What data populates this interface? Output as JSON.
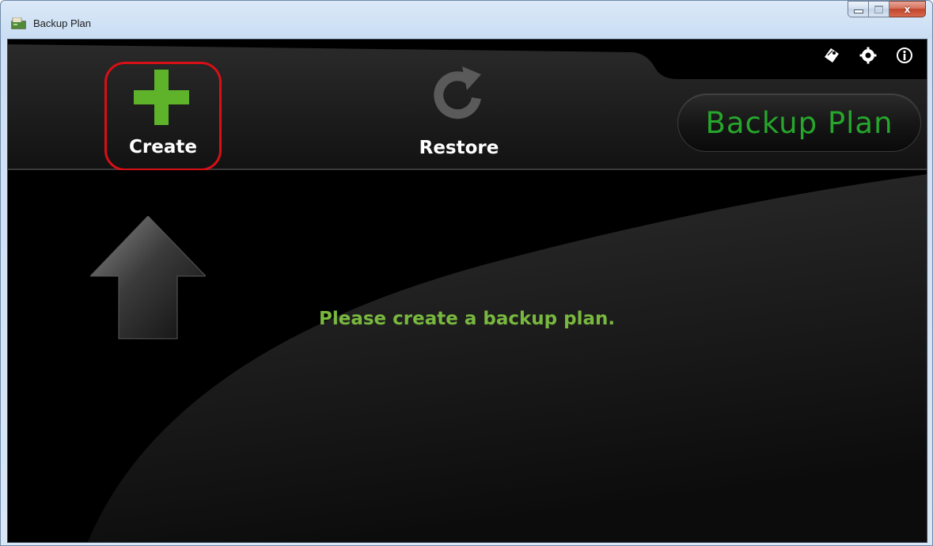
{
  "window": {
    "title": "Backup Plan",
    "controls": {
      "minimize_icon": "minimize-icon",
      "maximize_icon": "maximize-icon",
      "close_glyph": "x"
    }
  },
  "toolbar": {
    "create_label": "Create",
    "restore_label": "Restore",
    "create_icon": "plus-icon",
    "restore_icon": "refresh-icon",
    "top_icons": [
      "tag-icon",
      "gear-icon",
      "info-icon"
    ],
    "brand_label": "Backup Plan"
  },
  "main": {
    "message": "Please create a backup plan.",
    "hint_icon": "arrow-up-icon"
  },
  "colors": {
    "accent_green": "#79b83f",
    "brand_green": "#27a52c",
    "plus_green": "#5fb32b",
    "highlight_red": "#d80f16",
    "background": "#000000"
  }
}
